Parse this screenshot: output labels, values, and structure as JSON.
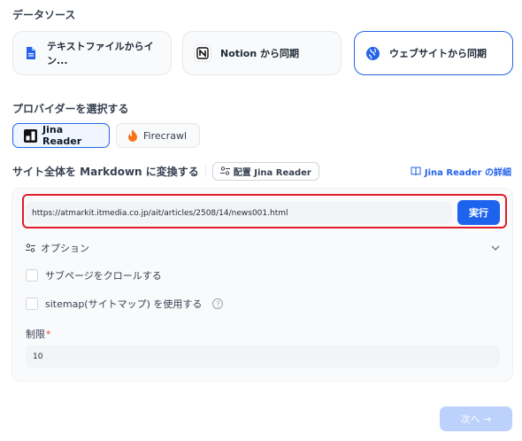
{
  "data_source": {
    "label": "データソース",
    "options": [
      {
        "label": "テキストファイルからイン...",
        "icon": "file-icon",
        "color": "#2563eb"
      },
      {
        "label": "Notion から同期",
        "icon": "notion-icon"
      },
      {
        "label": "ウェブサイトから同期",
        "icon": "globe-icon",
        "selected": true
      }
    ]
  },
  "provider": {
    "label": "プロバイダーを選択する",
    "options": [
      {
        "label": "Jina Reader",
        "icon": "jina-logo-icon",
        "selected": true
      },
      {
        "label": "Firecrawl",
        "icon": "flame-icon",
        "color": "#f97316"
      }
    ]
  },
  "convert": {
    "title": "サイト全体を Markdown に変換する",
    "config_label": "配置 Jina Reader",
    "detail_link": "Jina Reader の詳細"
  },
  "crawl": {
    "url_value": "https://atmarkit.itmedia.co.jp/ait/articles/2508/14/news001.html",
    "run_label": "実行",
    "options_label": "オプション",
    "crawl_subpages_label": "サブページをクロールする",
    "sitemap_label": "sitemap(サイトマップ) を使用する",
    "limit_label": "制限",
    "limit_required_mark": "*",
    "limit_value": "10"
  },
  "footer": {
    "next_label": "次へ →"
  },
  "colors": {
    "accent": "#2563eb",
    "highlight_frame": "#e11d2b",
    "next_disabled": "#bcd1fb"
  }
}
